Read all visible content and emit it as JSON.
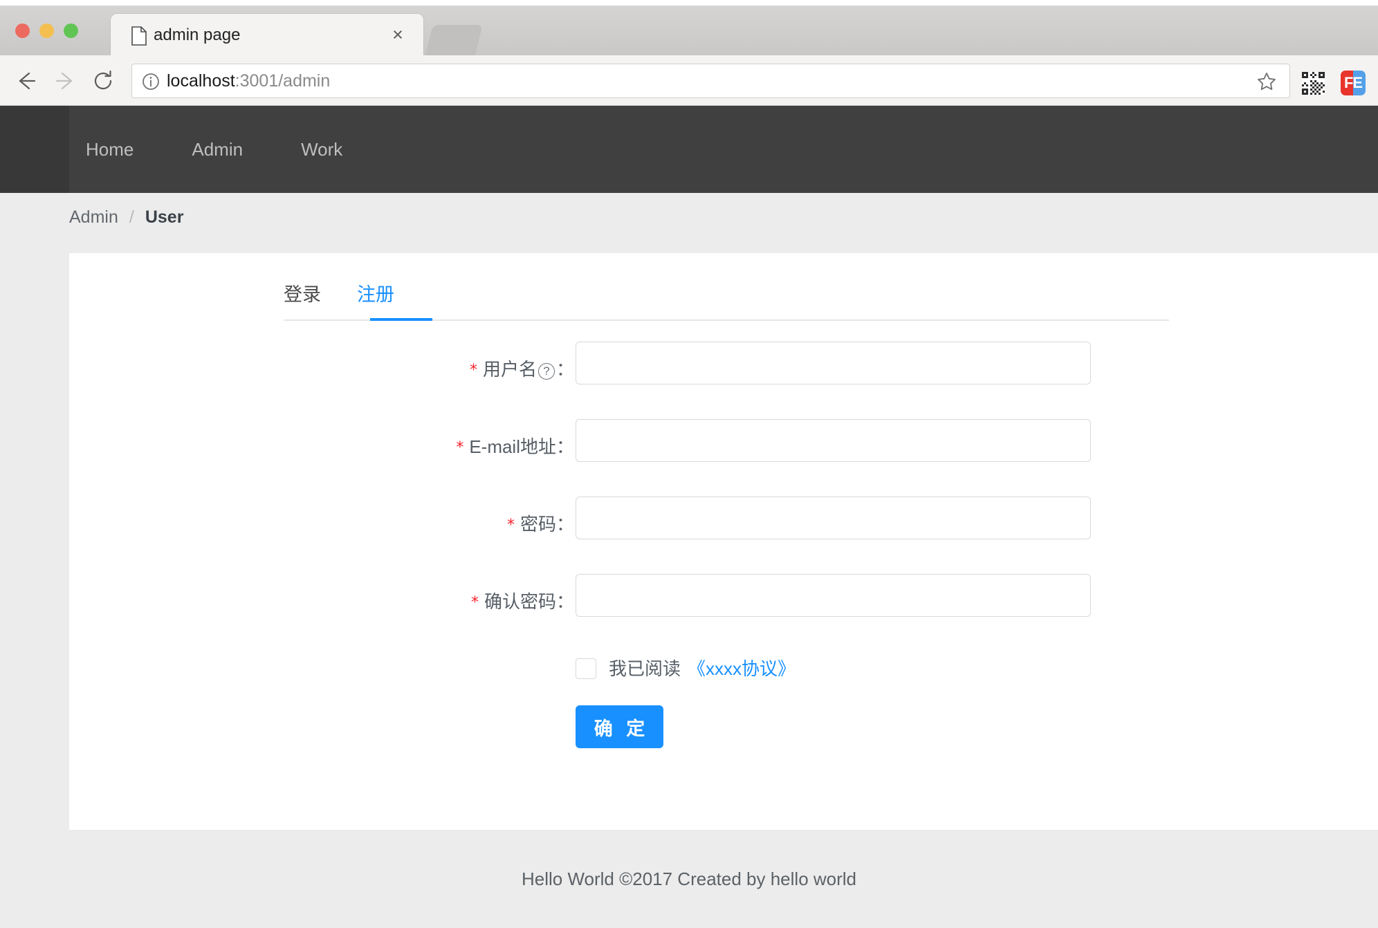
{
  "browser": {
    "tab": {
      "title": "admin page",
      "favicon": "page-icon",
      "close": "×"
    },
    "toolbar": {
      "back": "back-arrow",
      "forward": "forward-arrow",
      "reload": "reload-icon",
      "url_protocol_hint": "info-icon",
      "url_host": "localhost",
      "url_rest": ":3001/admin",
      "bookmark": "star-icon"
    },
    "extensions": [
      {
        "name": "qr-code-extension",
        "label": "QR"
      },
      {
        "name": "fe-extension",
        "label": "FE"
      }
    ]
  },
  "site_nav": {
    "items": [
      {
        "label": "Home"
      },
      {
        "label": "Admin"
      },
      {
        "label": "Work"
      }
    ]
  },
  "breadcrumb": {
    "parent": "Admin",
    "separator": "/",
    "current": "User"
  },
  "tabs": [
    {
      "label": "登录",
      "active": false
    },
    {
      "label": "注册",
      "active": true
    }
  ],
  "form": {
    "fields": [
      {
        "required": "*",
        "label": "用户名",
        "help_icon": "question-circle-icon",
        "colon": "：",
        "value": "",
        "placeholder": ""
      },
      {
        "required": "*",
        "label": "E-mail地址",
        "colon": "：",
        "value": "",
        "placeholder": ""
      },
      {
        "required": "*",
        "label": "密码",
        "colon": "：",
        "value": "",
        "placeholder": ""
      },
      {
        "required": "*",
        "label": "确认密码",
        "colon": "：",
        "value": "",
        "placeholder": ""
      }
    ],
    "agreement": {
      "checked": false,
      "text": "我已阅读",
      "link": "《xxxx协议》"
    },
    "submit_label": "确 定"
  },
  "footer": {
    "text": "Hello World ©2017 Created by hello world"
  },
  "colors": {
    "primary": "#1890ff",
    "required": "#f5222d",
    "nav_bg": "#404040",
    "nav_logo_bg": "#383838",
    "page_bg": "#ececec"
  }
}
